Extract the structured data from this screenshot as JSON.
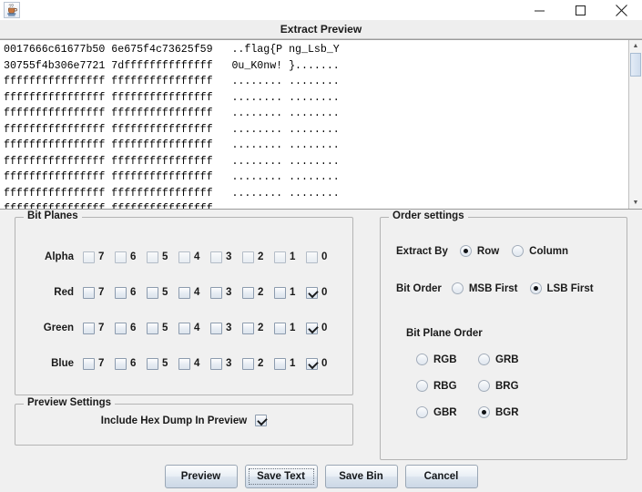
{
  "window": {
    "icon": "java-coffee-cup-icon",
    "minimize_label": "–",
    "maximize_label": "□",
    "close_label": "×"
  },
  "frame": {
    "title": "Extract Preview"
  },
  "hex_dump": {
    "lines": [
      "0017666c61677b50 6e675f4c73625f59   ..flag{P ng_Lsb_Y",
      "30755f4b306e7721 7dffffffffffffff   0u_K0nw! }.......",
      "ffffffffffffffff ffffffffffffffff   ........ ........",
      "ffffffffffffffff ffffffffffffffff   ........ ........",
      "ffffffffffffffff ffffffffffffffff   ........ ........",
      "ffffffffffffffff ffffffffffffffff   ........ ........",
      "ffffffffffffffff ffffffffffffffff   ........ ........",
      "ffffffffffffffff ffffffffffffffff   ........ ........",
      "ffffffffffffffff ffffffffffffffff   ........ ........",
      "ffffffffffffffff ffffffffffffffff   ........ ........",
      "ffffffffffffffff ffffffffffffffff   ........ ........"
    ]
  },
  "bit_planes": {
    "legend": "Bit Planes",
    "bits": [
      "7",
      "6",
      "5",
      "4",
      "3",
      "2",
      "1",
      "0"
    ],
    "rows": [
      {
        "label": "Alpha",
        "checked": [
          false,
          false,
          false,
          false,
          false,
          false,
          false,
          false
        ],
        "dim": true
      },
      {
        "label": "Red",
        "checked": [
          false,
          false,
          false,
          false,
          false,
          false,
          false,
          true
        ],
        "dim": false
      },
      {
        "label": "Green",
        "checked": [
          false,
          false,
          false,
          false,
          false,
          false,
          false,
          true
        ],
        "dim": false
      },
      {
        "label": "Blue",
        "checked": [
          false,
          false,
          false,
          false,
          false,
          false,
          false,
          true
        ],
        "dim": false
      }
    ]
  },
  "order_settings": {
    "legend": "Order settings",
    "extract_by": {
      "label": "Extract By",
      "options": [
        "Row",
        "Column"
      ],
      "selected": "Row"
    },
    "bit_order": {
      "label": "Bit Order",
      "options": [
        "MSB First",
        "LSB First"
      ],
      "selected": "LSB First"
    },
    "bit_plane_order": {
      "label": "Bit Plane Order",
      "options": [
        "RGB",
        "GRB",
        "RBG",
        "BRG",
        "GBR",
        "BGR"
      ],
      "selected": "BGR"
    }
  },
  "preview_settings": {
    "legend": "Preview Settings",
    "include_hex_dump": {
      "label": "Include Hex Dump In Preview",
      "checked": true
    }
  },
  "buttons": [
    {
      "label": "Preview",
      "focused": false
    },
    {
      "label": "Save Text",
      "focused": true
    },
    {
      "label": "Save Bin",
      "focused": false
    },
    {
      "label": "Cancel",
      "focused": false
    }
  ]
}
